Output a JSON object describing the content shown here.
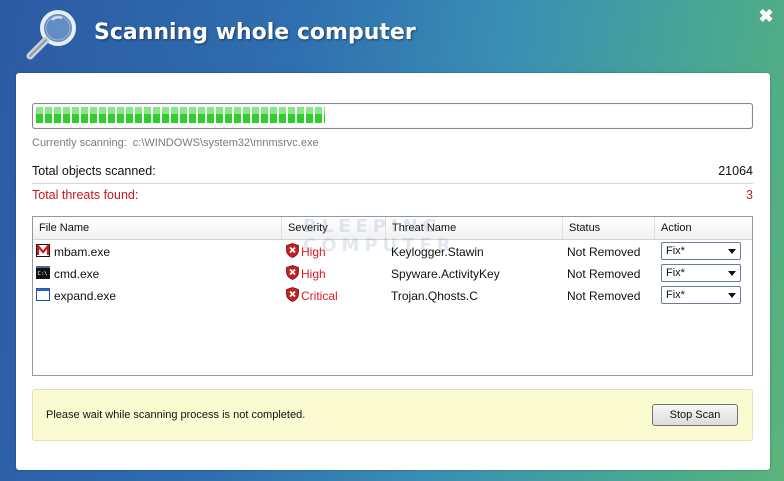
{
  "window": {
    "title": "Scanning whole computer",
    "close_glyph": "✖"
  },
  "progress": {
    "fraction": 0.405
  },
  "scan": {
    "label": "Currently scanning:",
    "path": "c:\\WINDOWS\\system32\\mnmsrvc.exe"
  },
  "stats": {
    "objects_label": "Total objects scanned:",
    "objects_value": "21064",
    "threats_label": "Total threats found:",
    "threats_value": "3"
  },
  "table": {
    "headers": {
      "file": "File Name",
      "severity": "Severity",
      "threat": "Threat Name",
      "status": "Status",
      "action": "Action"
    },
    "rows": [
      {
        "file": "mbam.exe",
        "file_icon": "mbam-icon",
        "severity": "High",
        "threat": "Keylogger.Stawin",
        "status": "Not Removed",
        "action": "Fix*"
      },
      {
        "file": "cmd.exe",
        "file_icon": "cmd-icon",
        "severity": "High",
        "threat": "Spyware.ActivityKey",
        "status": "Not Removed",
        "action": "Fix*"
      },
      {
        "file": "expand.exe",
        "file_icon": "window-icon",
        "severity": "Critical",
        "threat": "Trojan.Qhosts.C",
        "status": "Not Removed",
        "action": "Fix*"
      }
    ]
  },
  "watermark": {
    "line1": "BLEEPING",
    "line2": "COMPUTER"
  },
  "notice": {
    "text": "Please wait while scanning process is not completed.",
    "stop_label": "Stop Scan"
  },
  "colors": {
    "progress": "#2ecf2a",
    "threat_red": "#c91818",
    "notice_bg": "#fbfbd1"
  }
}
